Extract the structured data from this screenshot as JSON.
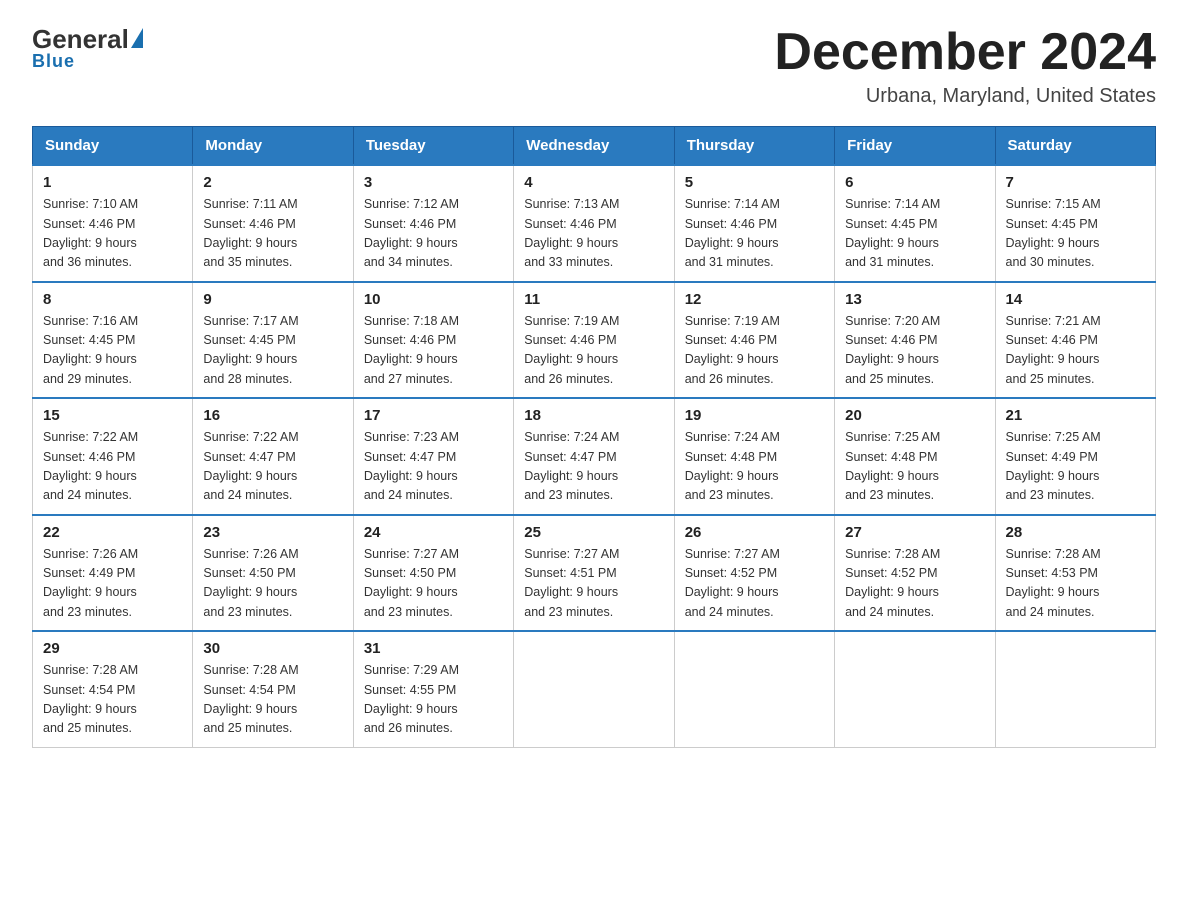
{
  "logo": {
    "general": "General",
    "blue": "Blue",
    "underline": "Blue"
  },
  "header": {
    "month_title": "December 2024",
    "location": "Urbana, Maryland, United States"
  },
  "days_of_week": [
    "Sunday",
    "Monday",
    "Tuesday",
    "Wednesday",
    "Thursday",
    "Friday",
    "Saturday"
  ],
  "weeks": [
    [
      {
        "day": "1",
        "sunrise": "7:10 AM",
        "sunset": "4:46 PM",
        "daylight": "9 hours and 36 minutes."
      },
      {
        "day": "2",
        "sunrise": "7:11 AM",
        "sunset": "4:46 PM",
        "daylight": "9 hours and 35 minutes."
      },
      {
        "day": "3",
        "sunrise": "7:12 AM",
        "sunset": "4:46 PM",
        "daylight": "9 hours and 34 minutes."
      },
      {
        "day": "4",
        "sunrise": "7:13 AM",
        "sunset": "4:46 PM",
        "daylight": "9 hours and 33 minutes."
      },
      {
        "day": "5",
        "sunrise": "7:14 AM",
        "sunset": "4:46 PM",
        "daylight": "9 hours and 31 minutes."
      },
      {
        "day": "6",
        "sunrise": "7:14 AM",
        "sunset": "4:45 PM",
        "daylight": "9 hours and 31 minutes."
      },
      {
        "day": "7",
        "sunrise": "7:15 AM",
        "sunset": "4:45 PM",
        "daylight": "9 hours and 30 minutes."
      }
    ],
    [
      {
        "day": "8",
        "sunrise": "7:16 AM",
        "sunset": "4:45 PM",
        "daylight": "9 hours and 29 minutes."
      },
      {
        "day": "9",
        "sunrise": "7:17 AM",
        "sunset": "4:45 PM",
        "daylight": "9 hours and 28 minutes."
      },
      {
        "day": "10",
        "sunrise": "7:18 AM",
        "sunset": "4:46 PM",
        "daylight": "9 hours and 27 minutes."
      },
      {
        "day": "11",
        "sunrise": "7:19 AM",
        "sunset": "4:46 PM",
        "daylight": "9 hours and 26 minutes."
      },
      {
        "day": "12",
        "sunrise": "7:19 AM",
        "sunset": "4:46 PM",
        "daylight": "9 hours and 26 minutes."
      },
      {
        "day": "13",
        "sunrise": "7:20 AM",
        "sunset": "4:46 PM",
        "daylight": "9 hours and 25 minutes."
      },
      {
        "day": "14",
        "sunrise": "7:21 AM",
        "sunset": "4:46 PM",
        "daylight": "9 hours and 25 minutes."
      }
    ],
    [
      {
        "day": "15",
        "sunrise": "7:22 AM",
        "sunset": "4:46 PM",
        "daylight": "9 hours and 24 minutes."
      },
      {
        "day": "16",
        "sunrise": "7:22 AM",
        "sunset": "4:47 PM",
        "daylight": "9 hours and 24 minutes."
      },
      {
        "day": "17",
        "sunrise": "7:23 AM",
        "sunset": "4:47 PM",
        "daylight": "9 hours and 24 minutes."
      },
      {
        "day": "18",
        "sunrise": "7:24 AM",
        "sunset": "4:47 PM",
        "daylight": "9 hours and 23 minutes."
      },
      {
        "day": "19",
        "sunrise": "7:24 AM",
        "sunset": "4:48 PM",
        "daylight": "9 hours and 23 minutes."
      },
      {
        "day": "20",
        "sunrise": "7:25 AM",
        "sunset": "4:48 PM",
        "daylight": "9 hours and 23 minutes."
      },
      {
        "day": "21",
        "sunrise": "7:25 AM",
        "sunset": "4:49 PM",
        "daylight": "9 hours and 23 minutes."
      }
    ],
    [
      {
        "day": "22",
        "sunrise": "7:26 AM",
        "sunset": "4:49 PM",
        "daylight": "9 hours and 23 minutes."
      },
      {
        "day": "23",
        "sunrise": "7:26 AM",
        "sunset": "4:50 PM",
        "daylight": "9 hours and 23 minutes."
      },
      {
        "day": "24",
        "sunrise": "7:27 AM",
        "sunset": "4:50 PM",
        "daylight": "9 hours and 23 minutes."
      },
      {
        "day": "25",
        "sunrise": "7:27 AM",
        "sunset": "4:51 PM",
        "daylight": "9 hours and 23 minutes."
      },
      {
        "day": "26",
        "sunrise": "7:27 AM",
        "sunset": "4:52 PM",
        "daylight": "9 hours and 24 minutes."
      },
      {
        "day": "27",
        "sunrise": "7:28 AM",
        "sunset": "4:52 PM",
        "daylight": "9 hours and 24 minutes."
      },
      {
        "day": "28",
        "sunrise": "7:28 AM",
        "sunset": "4:53 PM",
        "daylight": "9 hours and 24 minutes."
      }
    ],
    [
      {
        "day": "29",
        "sunrise": "7:28 AM",
        "sunset": "4:54 PM",
        "daylight": "9 hours and 25 minutes."
      },
      {
        "day": "30",
        "sunrise": "7:28 AM",
        "sunset": "4:54 PM",
        "daylight": "9 hours and 25 minutes."
      },
      {
        "day": "31",
        "sunrise": "7:29 AM",
        "sunset": "4:55 PM",
        "daylight": "9 hours and 26 minutes."
      },
      null,
      null,
      null,
      null
    ]
  ],
  "labels": {
    "sunrise": "Sunrise:",
    "sunset": "Sunset:",
    "daylight": "Daylight:"
  }
}
